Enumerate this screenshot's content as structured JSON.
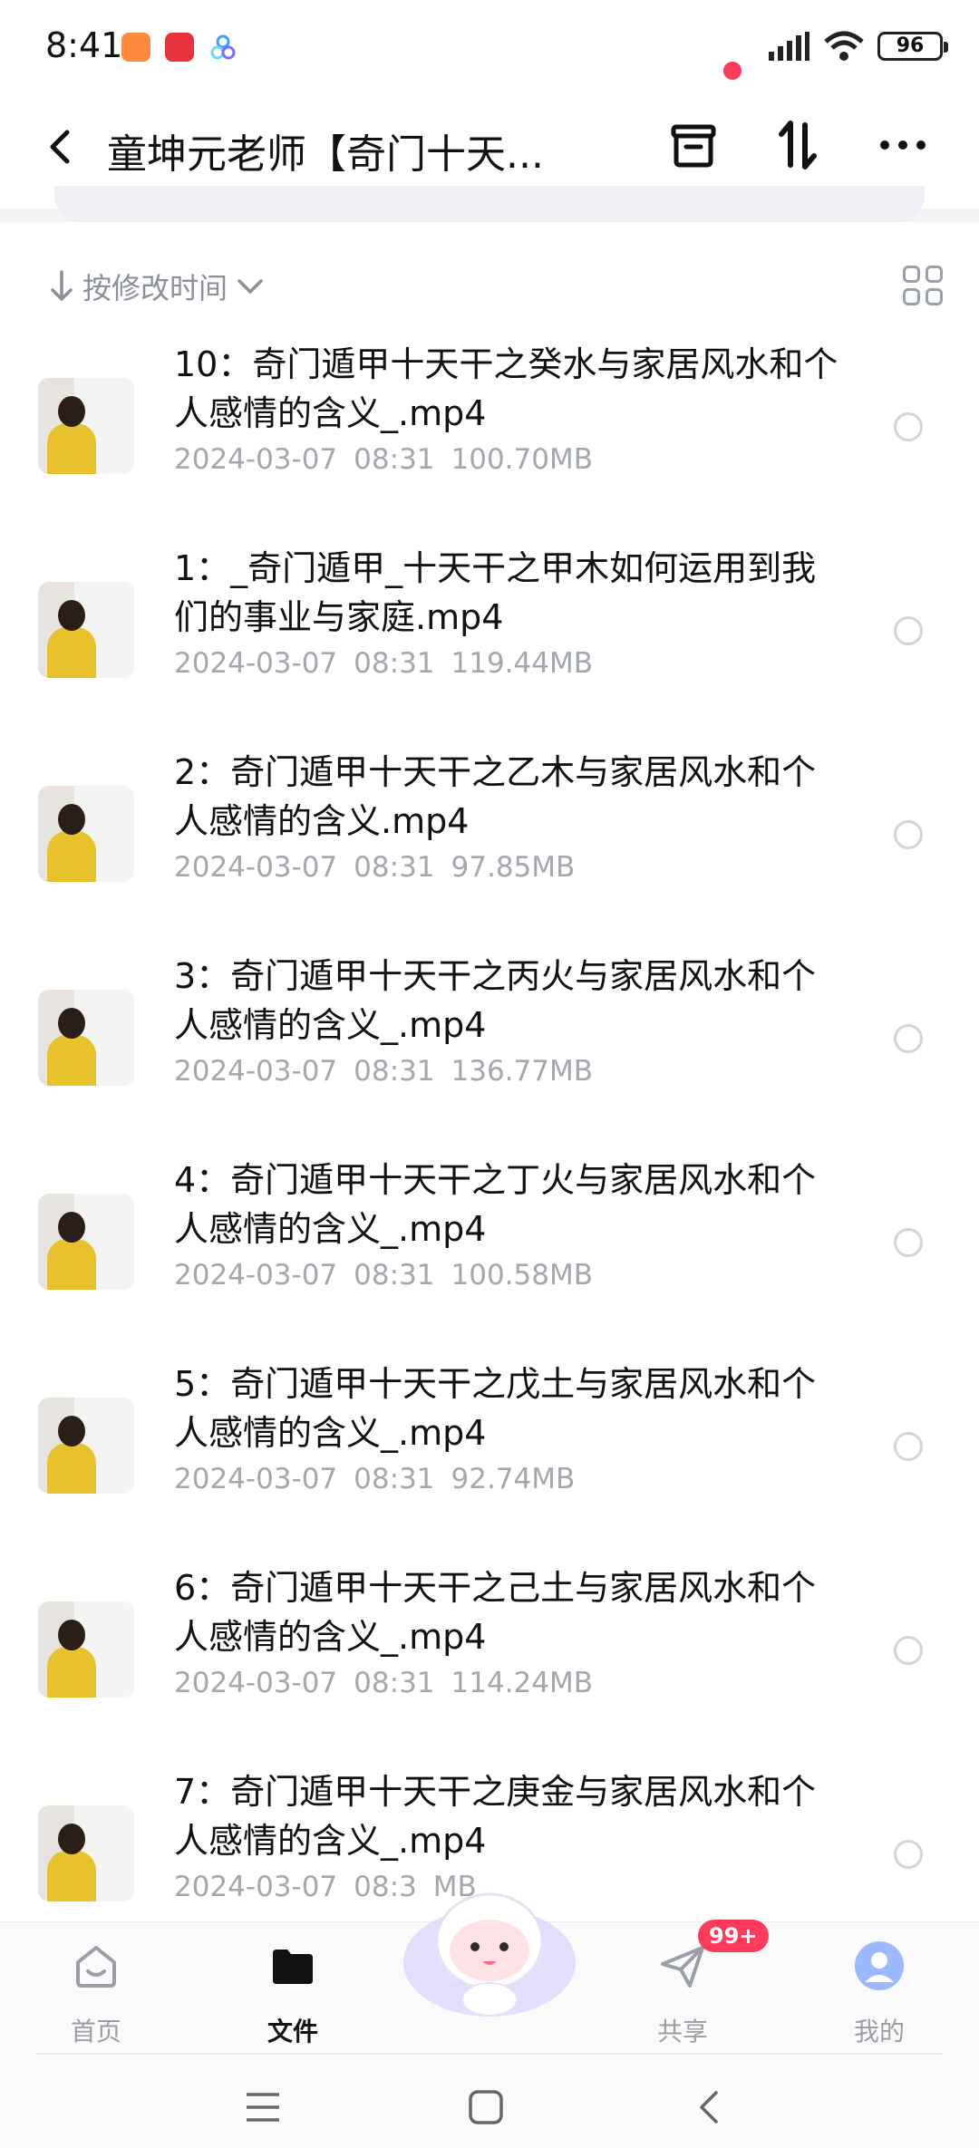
{
  "status_bar": {
    "time": "8:41",
    "battery": "96"
  },
  "header": {
    "title": "童坤元老师【奇门十天...",
    "accent_color": "#ff3b5c"
  },
  "sort": {
    "label": "按修改时间"
  },
  "files": [
    {
      "name": "10：奇门遁甲十天干之癸水与家居风水和个人感情的含义_.mp4",
      "date": "2024-03-07",
      "time": "08:31",
      "size": "100.70MB"
    },
    {
      "name": "1：_奇门遁甲_十天干之甲木如何运用到我们的事业与家庭.mp4",
      "date": "2024-03-07",
      "time": "08:31",
      "size": "119.44MB"
    },
    {
      "name": "2：奇门遁甲十天干之乙木与家居风水和个人感情的含义.mp4",
      "date": "2024-03-07",
      "time": "08:31",
      "size": "97.85MB"
    },
    {
      "name": "3：奇门遁甲十天干之丙火与家居风水和个人感情的含义_.mp4",
      "date": "2024-03-07",
      "time": "08:31",
      "size": "136.77MB"
    },
    {
      "name": "4：奇门遁甲十天干之丁火与家居风水和个人感情的含义_.mp4",
      "date": "2024-03-07",
      "time": "08:31",
      "size": "100.58MB"
    },
    {
      "name": "5：奇门遁甲十天干之戊土与家居风水和个人感情的含义_.mp4",
      "date": "2024-03-07",
      "time": "08:31",
      "size": "92.74MB"
    },
    {
      "name": "6：奇门遁甲十天干之己土与家居风水和个人感情的含义_.mp4",
      "date": "2024-03-07",
      "time": "08:31",
      "size": "114.24MB"
    },
    {
      "name": "7：奇门遁甲十天干之庚金与家居风水和个人感情的含义_.mp4",
      "date": "2024-03-07",
      "time": "08:3",
      "size": "MB"
    }
  ],
  "tabs": [
    {
      "label": "首页",
      "icon": "home-icon"
    },
    {
      "label": "文件",
      "icon": "folder-icon"
    },
    {
      "label": "共享",
      "icon": "send-icon"
    },
    {
      "label": "我的",
      "icon": "avatar-icon"
    }
  ],
  "share_badge": "99+"
}
